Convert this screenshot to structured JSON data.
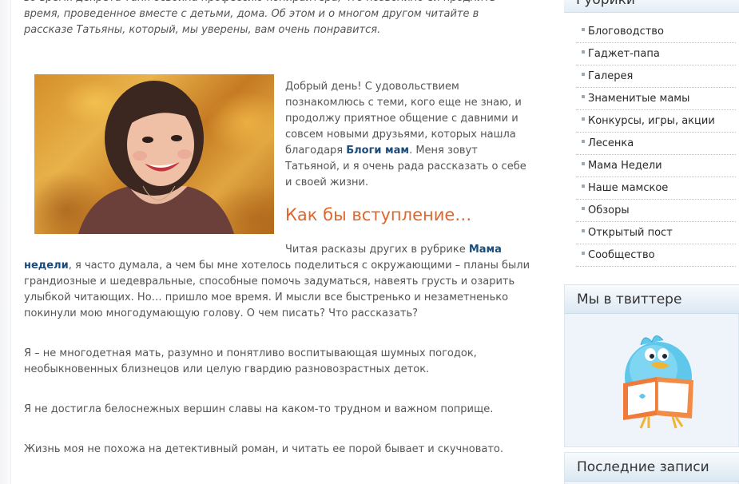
{
  "article": {
    "intro_line1": "во время декрета Таня освоила профессию копирайтера, что позволило ей продлить",
    "intro_line2": "время, проведенное вместе с детьми, дома. Об этом и о многом другом читайте в",
    "intro_line3": "рассказе Татьяны, который, мы уверены, вам очень понравится.",
    "greeting_before_link": "Добрый день! С удовольствием познакомлюсь с теми, кого еще не знаю, и продолжу приятное общение с давними и совсем новыми друзьями, которых нашла благодаря ",
    "blogs_link": "Блоги мам",
    "greeting_after_link": ". Меня зовут Татьяной, и я очень рада рассказать о себе и своей жизни.",
    "section_heading": "Как бы вступление…",
    "p2_before_link": "Читая расказы других в рубрике ",
    "mama_week_link": "Мама недели",
    "p2_after_link": ", я часто думала, а чем бы мне хотелось поделиться с окружающими – планы были грандиозные и шедевральные, способные помочь задуматься, навеять грусть и озарить улыбкой читающих. Но… пришло мое время. И мысли все быстренько и незаметненько покинули мою многодумающую голову. О чем писать? Что рассказать?",
    "p3": "Я – не многодетная мать, разумно и понятливо воспитывающая шумных погодок, необыкновенных близнецов или целую гвардию разновозрастных деток.",
    "p4": "Я не достигла белоснежных вершин славы на каком-то трудном и важном поприще.",
    "p5": "Жизнь моя не похожа на детективный роман, и читать ее порой бывает и скучновато."
  },
  "sidebar": {
    "categories_title": "Рубрики",
    "categories": [
      {
        "label": "Блоговодство"
      },
      {
        "label": "Гаджет-папа"
      },
      {
        "label": "Галерея"
      },
      {
        "label": "Знаменитые мамы"
      },
      {
        "label": "Конкурсы, игры, акции"
      },
      {
        "label": "Лесенка"
      },
      {
        "label": "Мама Недели"
      },
      {
        "label": "Наше мамское"
      },
      {
        "label": "Обзоры"
      },
      {
        "label": "Открытый пост"
      },
      {
        "label": "Сообщество"
      }
    ],
    "twitter_title": "Мы в твиттере",
    "recent_title": "Последние записи",
    "twitter_icon": "twitter-bird-reading-book-icon"
  },
  "colors": {
    "link": "#1a4d7a",
    "heading_accent": "#e0662a",
    "sidebar_bg": "#eef4f9"
  }
}
